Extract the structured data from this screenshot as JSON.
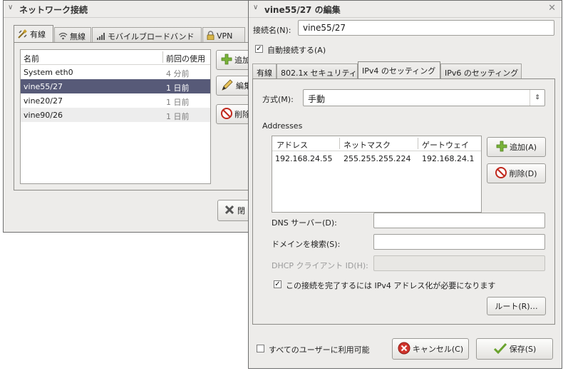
{
  "network_window": {
    "title": "ネットワーク接続",
    "tabs": [
      {
        "label": "有線",
        "icon": "wired-icon"
      },
      {
        "label": "無線",
        "icon": "wireless-icon"
      },
      {
        "label": "モバイルブロードバンド",
        "icon": "mobile-signal-icon"
      },
      {
        "label": "VPN",
        "icon": "lock-icon"
      }
    ],
    "list": {
      "headers": [
        "名前",
        "前回の使用"
      ],
      "rows": [
        {
          "name": "System eth0",
          "last_used": "4 分前"
        },
        {
          "name": "vine55/27",
          "last_used": "1 日前"
        },
        {
          "name": "vine20/27",
          "last_used": "1 日前"
        },
        {
          "name": "vine90/26",
          "last_used": "1 日前"
        }
      ]
    },
    "add_label": "追加",
    "edit_label": "編集",
    "delete_label": "削除",
    "close_label": "閉"
  },
  "edit_dialog": {
    "title": "vine55/27 の編集",
    "name_label": "接続名(N):",
    "name_value": "vine55/27",
    "auto_connect_label": "自動接続する(A)",
    "tabs": [
      "有線",
      "802.1x セキュリティ",
      "IPv4 のセッティング",
      "IPv6 のセッティング"
    ],
    "method_label": "方式(M):",
    "method_value": "手動",
    "addresses_heading": "Addresses",
    "address_table": {
      "headers": [
        "アドレス",
        "ネットマスク",
        "ゲートウェイ"
      ],
      "rows": [
        [
          "192.168.24.55",
          "255.255.255.224",
          "192.168.24.1"
        ]
      ]
    },
    "add_button": "追加(A)",
    "delete_button": "削除(D)",
    "dns_label": "DNS サーバー(D):",
    "dns_value": "",
    "search_label": "ドメインを検索(S):",
    "search_value": "",
    "dhcp_label": "DHCP クライアント ID(H):",
    "dhcp_value": "",
    "require_ipv4_label": "この接続を完了するには IPv4 アドレス化が必要になります",
    "routes_button": "ルート(R)…",
    "all_users_label": "すべてのユーザーに利用可能",
    "cancel_button": "キャンセル(C)",
    "save_button": "保存(S)"
  },
  "colors": {
    "selection": "#575a78",
    "window_bg": "#edecea"
  }
}
